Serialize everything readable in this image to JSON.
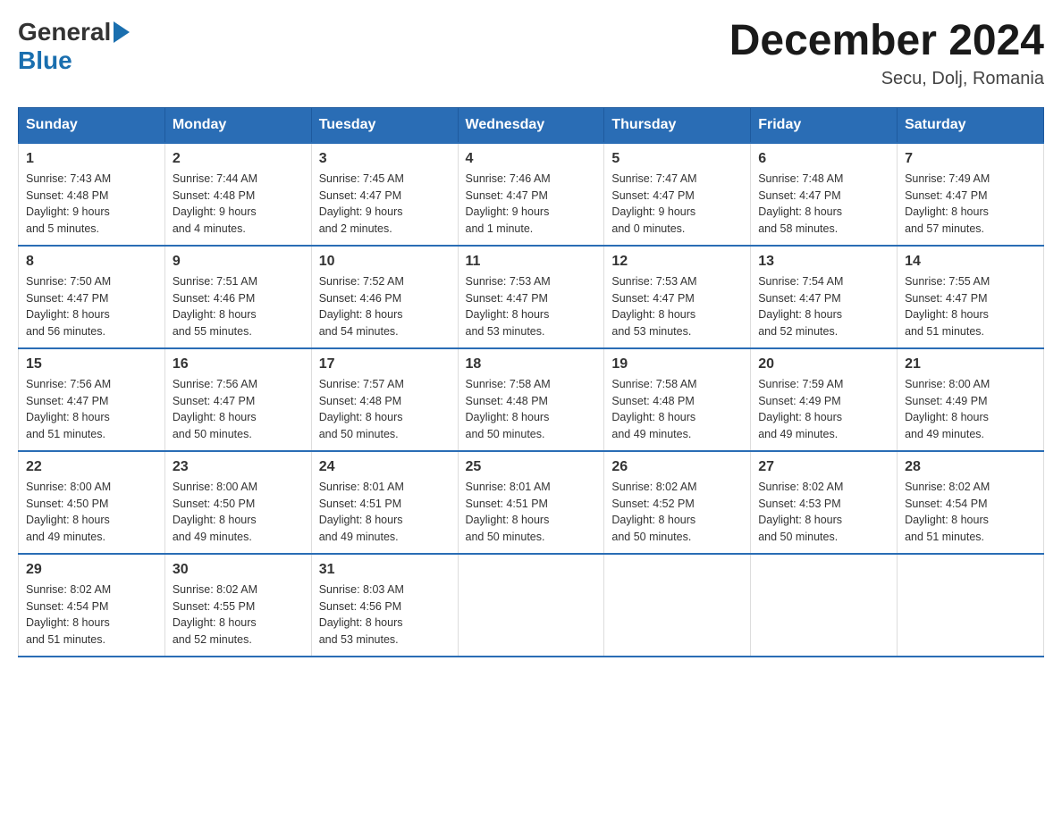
{
  "header": {
    "logo_general": "General",
    "logo_blue": "Blue",
    "main_title": "December 2024",
    "sub_title": "Secu, Dolj, Romania"
  },
  "calendar": {
    "days_of_week": [
      "Sunday",
      "Monday",
      "Tuesday",
      "Wednesday",
      "Thursday",
      "Friday",
      "Saturday"
    ],
    "weeks": [
      [
        {
          "day": "1",
          "info": "Sunrise: 7:43 AM\nSunset: 4:48 PM\nDaylight: 9 hours\nand 5 minutes."
        },
        {
          "day": "2",
          "info": "Sunrise: 7:44 AM\nSunset: 4:48 PM\nDaylight: 9 hours\nand 4 minutes."
        },
        {
          "day": "3",
          "info": "Sunrise: 7:45 AM\nSunset: 4:47 PM\nDaylight: 9 hours\nand 2 minutes."
        },
        {
          "day": "4",
          "info": "Sunrise: 7:46 AM\nSunset: 4:47 PM\nDaylight: 9 hours\nand 1 minute."
        },
        {
          "day": "5",
          "info": "Sunrise: 7:47 AM\nSunset: 4:47 PM\nDaylight: 9 hours\nand 0 minutes."
        },
        {
          "day": "6",
          "info": "Sunrise: 7:48 AM\nSunset: 4:47 PM\nDaylight: 8 hours\nand 58 minutes."
        },
        {
          "day": "7",
          "info": "Sunrise: 7:49 AM\nSunset: 4:47 PM\nDaylight: 8 hours\nand 57 minutes."
        }
      ],
      [
        {
          "day": "8",
          "info": "Sunrise: 7:50 AM\nSunset: 4:47 PM\nDaylight: 8 hours\nand 56 minutes."
        },
        {
          "day": "9",
          "info": "Sunrise: 7:51 AM\nSunset: 4:46 PM\nDaylight: 8 hours\nand 55 minutes."
        },
        {
          "day": "10",
          "info": "Sunrise: 7:52 AM\nSunset: 4:46 PM\nDaylight: 8 hours\nand 54 minutes."
        },
        {
          "day": "11",
          "info": "Sunrise: 7:53 AM\nSunset: 4:47 PM\nDaylight: 8 hours\nand 53 minutes."
        },
        {
          "day": "12",
          "info": "Sunrise: 7:53 AM\nSunset: 4:47 PM\nDaylight: 8 hours\nand 53 minutes."
        },
        {
          "day": "13",
          "info": "Sunrise: 7:54 AM\nSunset: 4:47 PM\nDaylight: 8 hours\nand 52 minutes."
        },
        {
          "day": "14",
          "info": "Sunrise: 7:55 AM\nSunset: 4:47 PM\nDaylight: 8 hours\nand 51 minutes."
        }
      ],
      [
        {
          "day": "15",
          "info": "Sunrise: 7:56 AM\nSunset: 4:47 PM\nDaylight: 8 hours\nand 51 minutes."
        },
        {
          "day": "16",
          "info": "Sunrise: 7:56 AM\nSunset: 4:47 PM\nDaylight: 8 hours\nand 50 minutes."
        },
        {
          "day": "17",
          "info": "Sunrise: 7:57 AM\nSunset: 4:48 PM\nDaylight: 8 hours\nand 50 minutes."
        },
        {
          "day": "18",
          "info": "Sunrise: 7:58 AM\nSunset: 4:48 PM\nDaylight: 8 hours\nand 50 minutes."
        },
        {
          "day": "19",
          "info": "Sunrise: 7:58 AM\nSunset: 4:48 PM\nDaylight: 8 hours\nand 49 minutes."
        },
        {
          "day": "20",
          "info": "Sunrise: 7:59 AM\nSunset: 4:49 PM\nDaylight: 8 hours\nand 49 minutes."
        },
        {
          "day": "21",
          "info": "Sunrise: 8:00 AM\nSunset: 4:49 PM\nDaylight: 8 hours\nand 49 minutes."
        }
      ],
      [
        {
          "day": "22",
          "info": "Sunrise: 8:00 AM\nSunset: 4:50 PM\nDaylight: 8 hours\nand 49 minutes."
        },
        {
          "day": "23",
          "info": "Sunrise: 8:00 AM\nSunset: 4:50 PM\nDaylight: 8 hours\nand 49 minutes."
        },
        {
          "day": "24",
          "info": "Sunrise: 8:01 AM\nSunset: 4:51 PM\nDaylight: 8 hours\nand 49 minutes."
        },
        {
          "day": "25",
          "info": "Sunrise: 8:01 AM\nSunset: 4:51 PM\nDaylight: 8 hours\nand 50 minutes."
        },
        {
          "day": "26",
          "info": "Sunrise: 8:02 AM\nSunset: 4:52 PM\nDaylight: 8 hours\nand 50 minutes."
        },
        {
          "day": "27",
          "info": "Sunrise: 8:02 AM\nSunset: 4:53 PM\nDaylight: 8 hours\nand 50 minutes."
        },
        {
          "day": "28",
          "info": "Sunrise: 8:02 AM\nSunset: 4:54 PM\nDaylight: 8 hours\nand 51 minutes."
        }
      ],
      [
        {
          "day": "29",
          "info": "Sunrise: 8:02 AM\nSunset: 4:54 PM\nDaylight: 8 hours\nand 51 minutes."
        },
        {
          "day": "30",
          "info": "Sunrise: 8:02 AM\nSunset: 4:55 PM\nDaylight: 8 hours\nand 52 minutes."
        },
        {
          "day": "31",
          "info": "Sunrise: 8:03 AM\nSunset: 4:56 PM\nDaylight: 8 hours\nand 53 minutes."
        },
        {
          "day": "",
          "info": ""
        },
        {
          "day": "",
          "info": ""
        },
        {
          "day": "",
          "info": ""
        },
        {
          "day": "",
          "info": ""
        }
      ]
    ]
  }
}
